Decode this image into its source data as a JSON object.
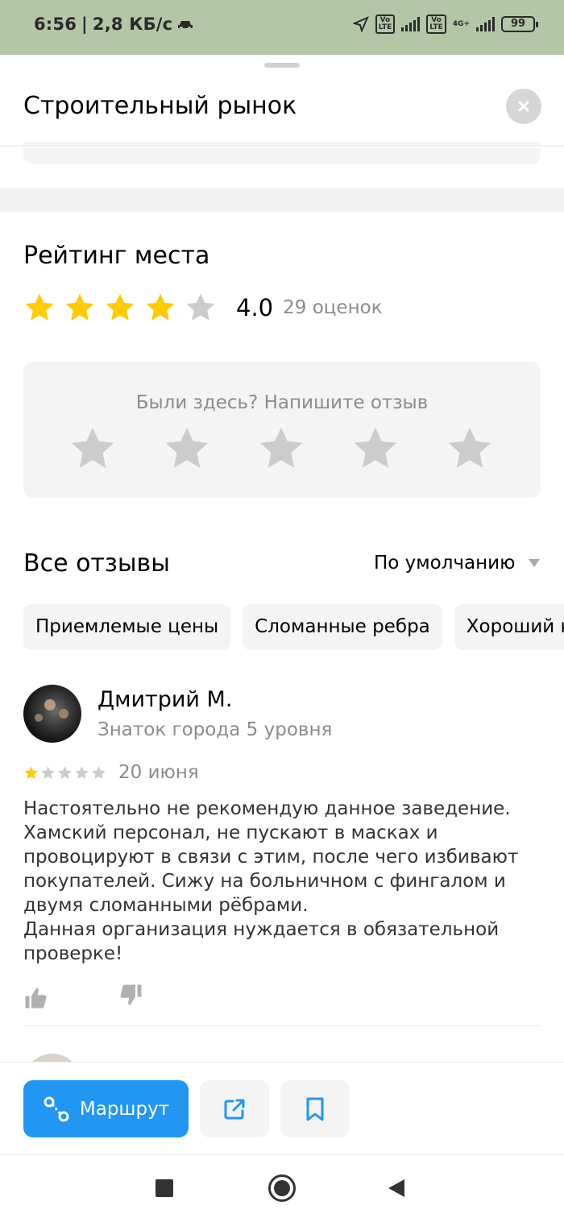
{
  "status_bar": {
    "time": "6:56",
    "speed": "2,8 КБ/с",
    "volte1": "Vo\nLTE",
    "volte2": "Vo\nLTE",
    "network": "4G+",
    "battery": "99"
  },
  "sheet": {
    "title": "Строительный рынок",
    "close_icon": "close-icon"
  },
  "rating": {
    "title": "Рейтинг места",
    "stars_filled": 4,
    "stars_total": 5,
    "value": "4.0",
    "count": "29 оценок"
  },
  "write_review": {
    "prompt": "Были здесь? Напишите отзыв"
  },
  "reviews": {
    "title": "Все отзывы",
    "sort": "По умолчанию",
    "chips": [
      "Приемлемые цены",
      "Сломанные ребра",
      "Хороший к"
    ],
    "items": [
      {
        "author": "Дмитрий М.",
        "level": "Знаток города 5 уровня",
        "stars": 1,
        "date": "20 июня",
        "text": "Настоятельно не рекомендую данное заведение. Хамский персонал, не пускают в масках и провоцируют в связи с этим, после чего избивают покупателей. Сижу на больничном с фингалом и двумя сломанными рёбрами.\nДанная организация нуждается в обязательной проверке!"
      }
    ]
  },
  "actions": {
    "route_label": "Маршрут"
  },
  "colors": {
    "accent": "#2196f3",
    "star_filled": "#ffcc00",
    "star_empty": "#cccccc",
    "status_bar": "#b3c6a5"
  },
  "icons": {
    "route": "route-icon",
    "share": "share-icon",
    "bookmark": "bookmark-icon",
    "like": "thumbs-up-icon",
    "dislike": "thumbs-down-icon"
  }
}
